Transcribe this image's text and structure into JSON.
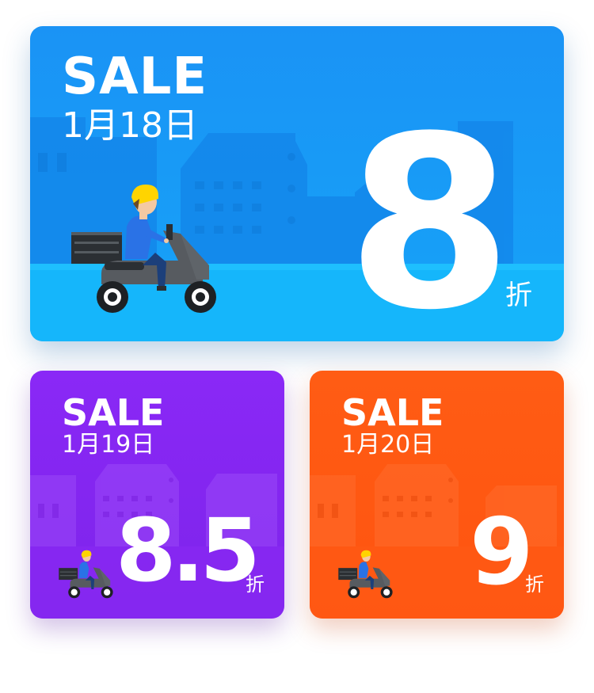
{
  "cards": {
    "main": {
      "sale": "SALE",
      "date": "1月18日",
      "discount": "8",
      "unit": "折",
      "color": "#1a93f5"
    },
    "purple": {
      "sale": "SALE",
      "date": "1月19日",
      "discount": "8.5",
      "unit": "折",
      "color": "#8a28f6"
    },
    "orange": {
      "sale": "SALE",
      "date": "1月20日",
      "discount": "9",
      "unit": "折",
      "color": "#ff5c14"
    }
  },
  "icons": [
    "delivery-rider-icon",
    "city-skyline-icon"
  ]
}
